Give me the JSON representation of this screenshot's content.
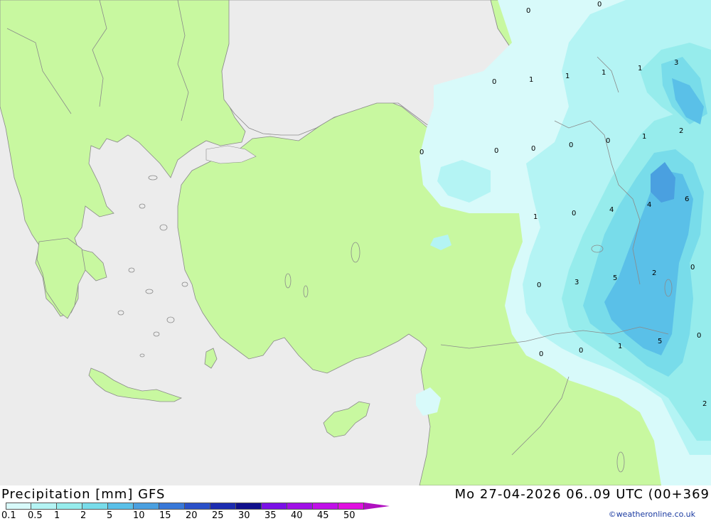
{
  "header": {
    "title": "Precipitation [mm] GFS",
    "datetime": "Mo 27-04-2026 06..09 UTC (00+369"
  },
  "legend": {
    "colors": [
      "#d8fafa",
      "#b4f4f4",
      "#96ecec",
      "#78dcea",
      "#5ac0e8",
      "#4aa0e0",
      "#3878d8",
      "#2a50c8",
      "#1c2cb0",
      "#10108c",
      "#7a10e6",
      "#a010e6",
      "#c010e8",
      "#e010e0",
      "#b010c0"
    ],
    "labels": [
      "0.1",
      "0.5",
      "1",
      "2",
      "5",
      "10",
      "15",
      "20",
      "25",
      "30",
      "35",
      "40",
      "45",
      "50"
    ]
  },
  "credit": "©weatheronline.co.uk",
  "map": {
    "land_color": "#c8f8a0",
    "sea_color": "#ececec",
    "border_color": "#8a8a8a",
    "value_labels": [
      "0",
      "0",
      "0",
      "1",
      "1",
      "1",
      "1",
      "3",
      "2",
      "1",
      "0",
      "0",
      "0",
      "0",
      "0",
      "1",
      "0",
      "4",
      "4",
      "6",
      "0",
      "3",
      "5",
      "2",
      "0",
      "0",
      "0",
      "1",
      "5",
      "0",
      "2"
    ]
  }
}
